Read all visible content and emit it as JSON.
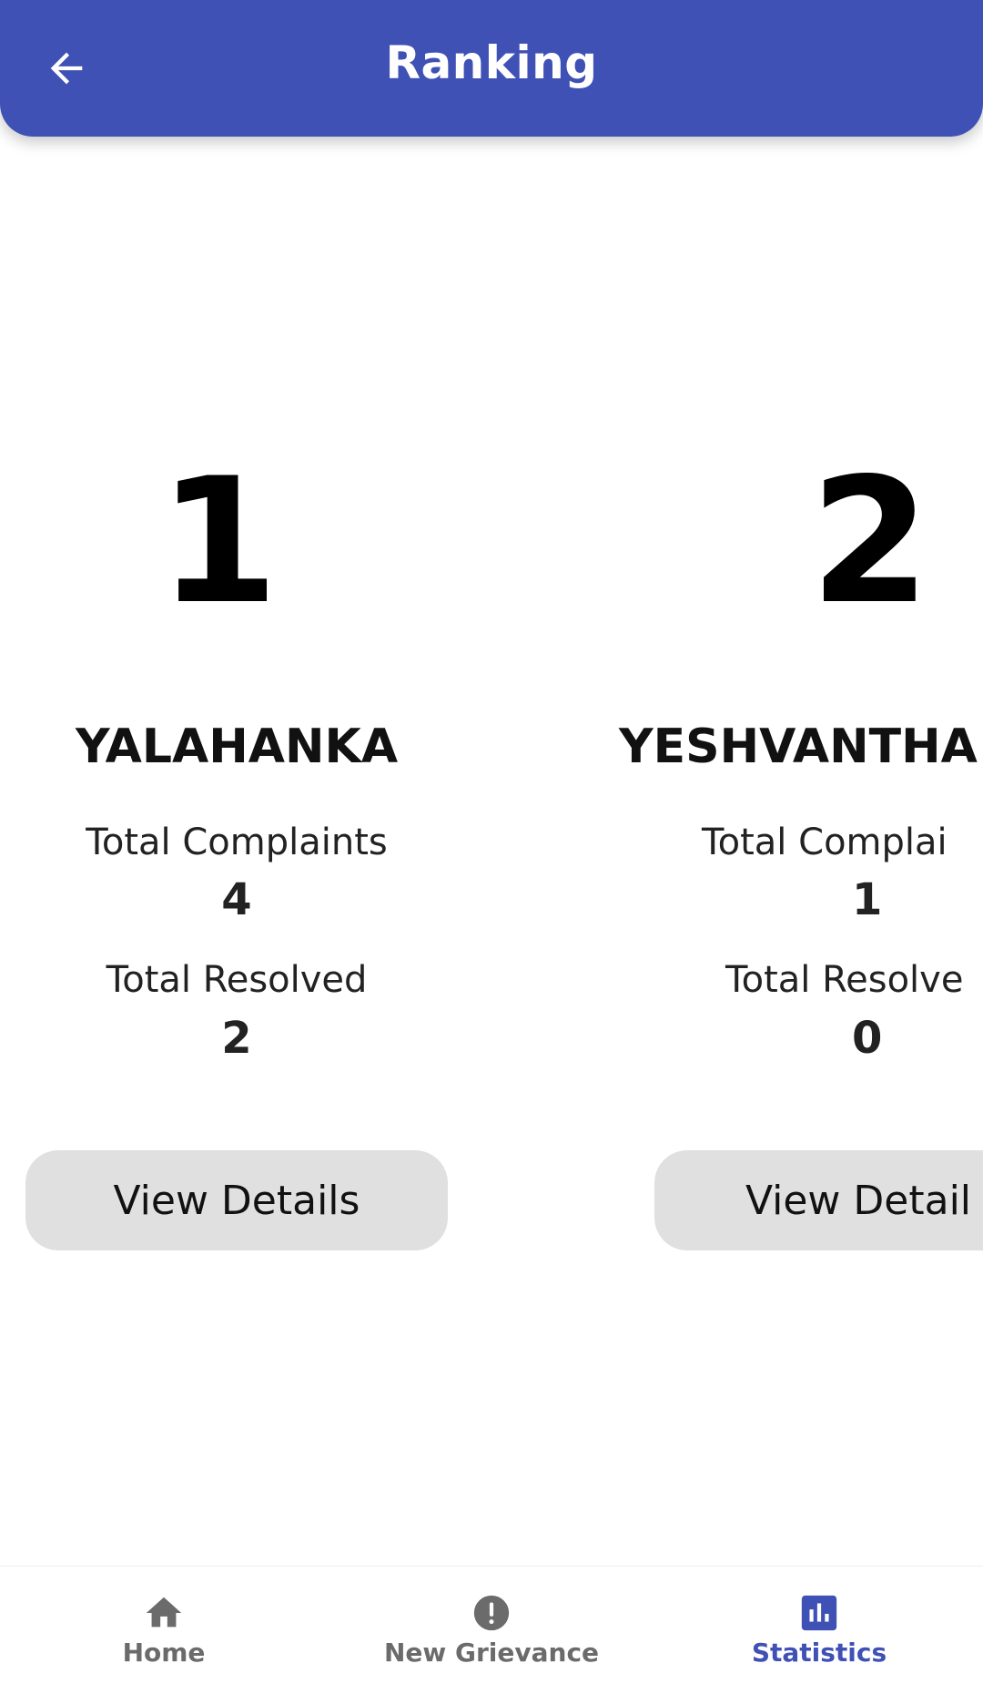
{
  "header": {
    "title": "Ranking"
  },
  "rankings": [
    {
      "rank": "1",
      "zone": "YALAHANKA",
      "complaints_label": "Total Complaints",
      "complaints_value": "4",
      "resolved_label": "Total Resolved",
      "resolved_value": "2",
      "button_label": "View Details"
    },
    {
      "rank": "2",
      "zone": "YESHVANTHA",
      "complaints_label": "Total Complai",
      "complaints_value": "1",
      "resolved_label": "Total Resolve",
      "resolved_value": "0",
      "button_label": "View Detail"
    }
  ],
  "bottom_nav": {
    "items": [
      {
        "label": "Home",
        "icon": "home-icon",
        "active": false
      },
      {
        "label": "New Grievance",
        "icon": "alert-circle-icon",
        "active": false
      },
      {
        "label": "Statistics",
        "icon": "bar-chart-icon",
        "active": true
      }
    ]
  },
  "colors": {
    "primary": "#3f51b5",
    "inactive_nav": "#6b6b6b",
    "button_bg": "#e0e0e0"
  }
}
